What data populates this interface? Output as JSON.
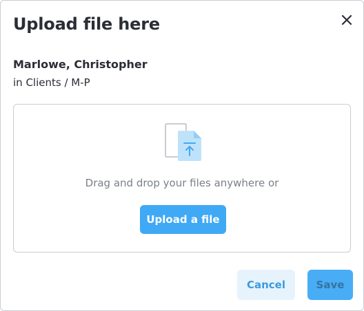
{
  "dialog": {
    "title": "Upload file here",
    "close_icon": "close-icon"
  },
  "client": {
    "name": "Marlowe, Christopher",
    "path": "in Clients / M-P"
  },
  "dropzone": {
    "icon": "file-upload-icon",
    "instruction": "Drag and drop your files anywhere or",
    "upload_label": "Upload a file"
  },
  "footer": {
    "cancel_label": "Cancel",
    "save_label": "Save"
  },
  "colors": {
    "accent": "#3fa9f5",
    "accent_light": "#e6f3fd",
    "text_dark": "#2a2d34",
    "text_muted": "#7a7f89",
    "border": "#c9ccd1"
  }
}
